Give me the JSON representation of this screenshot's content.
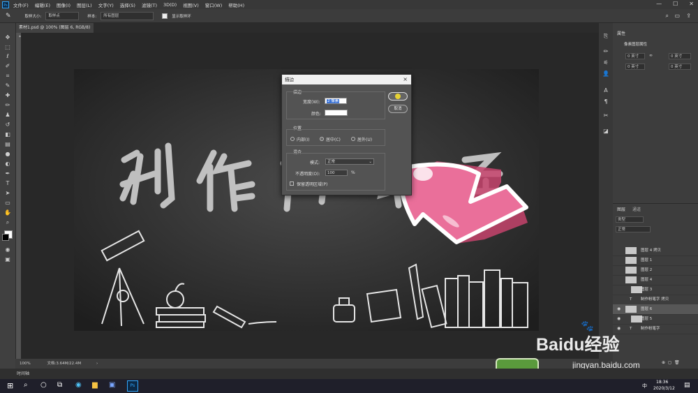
{
  "menubar": {
    "app_icon": "Ps",
    "items": [
      "文件(F)",
      "编辑(E)",
      "图像(I)",
      "图层(L)",
      "文字(Y)",
      "选择(S)",
      "滤镜(T)",
      "3D(D)",
      "视图(V)",
      "窗口(W)",
      "帮助(H)"
    ],
    "window_controls": [
      "—",
      "☐",
      "✕"
    ]
  },
  "optionsbar": {
    "sample_size_label": "取样大小:",
    "sample_size_value": "取样点",
    "sample_label": "样本:",
    "sample_value": "所有图层",
    "show_ring_label": "显示取样环"
  },
  "document": {
    "tab_title": "素材1.psd @ 100% (图层 6, RGB/8) *",
    "zoom": "100%",
    "doc_size": "文档:3.64M/22.4M"
  },
  "canvas": {
    "text": "制作粉笔字"
  },
  "dialog": {
    "title": "描边",
    "stroke_group": "描边",
    "width_label": "宽度(W):",
    "width_value": "2 像素",
    "color_label": "颜色:",
    "color_value": "#ffffff",
    "position_group": "位置",
    "pos_inside": "内部(I)",
    "pos_center": "居中(C)",
    "pos_outside": "居外(U)",
    "position_selected": "center",
    "blend_group": "混合",
    "mode_label": "模式:",
    "mode_value": "正常",
    "opacity_label": "不透明度(O):",
    "opacity_value": "100",
    "opacity_unit": "%",
    "preserve_label": "保留透明区域(P)",
    "ok_label": "确定",
    "cancel_label": "取消"
  },
  "properties": {
    "tab": "属性",
    "subtitle": "像素图层属性",
    "w_value": "0 英寸",
    "h_value": "0 英寸",
    "x_value": "0 英寸",
    "y_value": "0 英寸"
  },
  "layers": {
    "tabs": [
      "图层",
      "通道"
    ],
    "filter_label": "类型",
    "blend_value": "正常",
    "items": [
      {
        "name": "图层 4 拷贝",
        "visible": false,
        "type": "pixel"
      },
      {
        "name": "图层 1",
        "visible": false,
        "type": "pixel"
      },
      {
        "name": "图层 2",
        "visible": false,
        "type": "pixel"
      },
      {
        "name": "图层 4",
        "visible": false,
        "type": "pixel"
      },
      {
        "name": "图层 3",
        "visible": false,
        "type": "group"
      },
      {
        "name": "制作粉笔字 拷贝",
        "visible": false,
        "type": "text"
      },
      {
        "name": "图层 6",
        "visible": true,
        "type": "pixel",
        "selected": true
      },
      {
        "name": "图层 5",
        "visible": true,
        "type": "group"
      },
      {
        "name": "制作粉笔字",
        "visible": true,
        "type": "text"
      }
    ]
  },
  "timeline": {
    "label": "时间轴"
  },
  "taskbar": {
    "time": "18:36",
    "date": "2020/3/12",
    "lang": "中"
  },
  "watermark": {
    "text": "Baidu经验",
    "url": "jingyan.baidu.com"
  },
  "colors": {
    "accent_pink": "#e86a95",
    "dialog_bg": "#535353"
  }
}
